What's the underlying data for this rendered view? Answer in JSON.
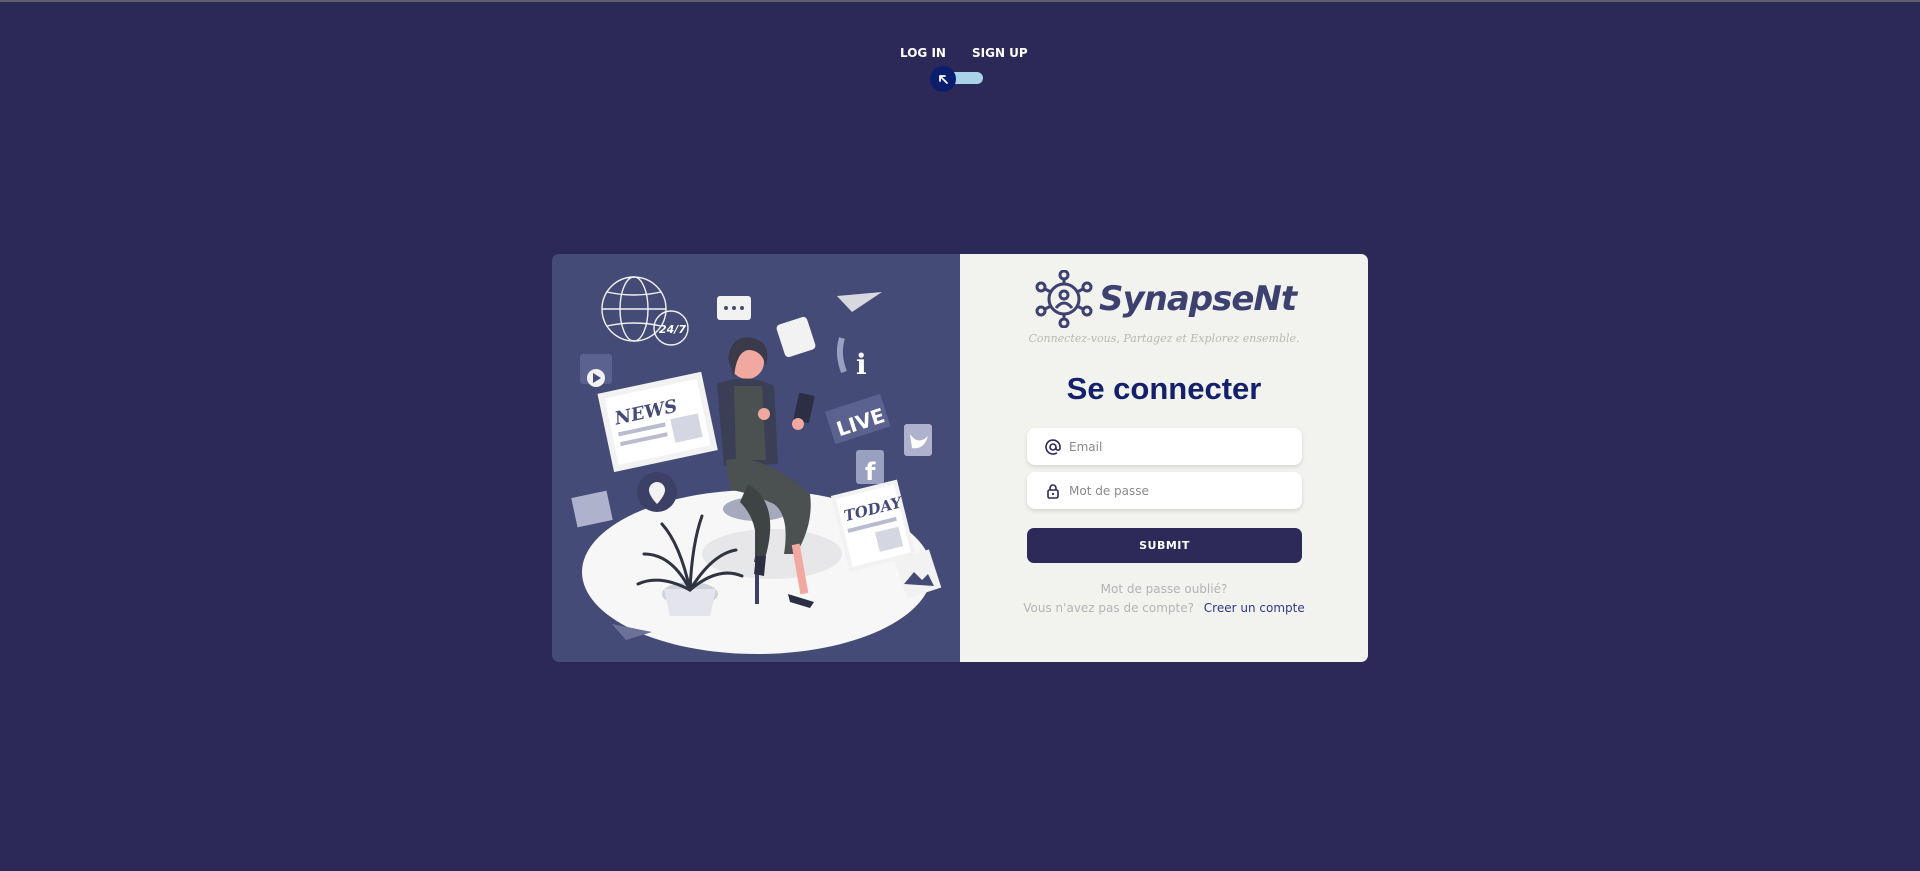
{
  "auth_switch": {
    "login_label": "LOG IN",
    "signup_label": "SIGN UP",
    "toggle_icon": "arrow-up-left-icon"
  },
  "brand": {
    "name": "SynapseNt",
    "tagline": "Connectez-vous, Partagez et Explorez ensemble.",
    "logo_icon": "network-people-icon"
  },
  "illustration": {
    "labels": [
      "NEWS",
      "LIVE",
      "TODAY",
      "24/7",
      "i"
    ]
  },
  "login_form": {
    "title": "Se connecter",
    "email_placeholder": "Email",
    "password_placeholder": "Mot de passe",
    "submit_label": "SUBMIT",
    "forgot_password": "Mot de passe oublié?",
    "no_account": "Vous n'avez pas de compte?",
    "create_account": "Creer un compte"
  },
  "colors": {
    "background": "#2c2858",
    "panel_left": "#454b77",
    "panel_right": "#f2f2ee",
    "accent": "#15206b",
    "toggle_track": "#a9d3e8",
    "button": "#2d2a5a"
  }
}
